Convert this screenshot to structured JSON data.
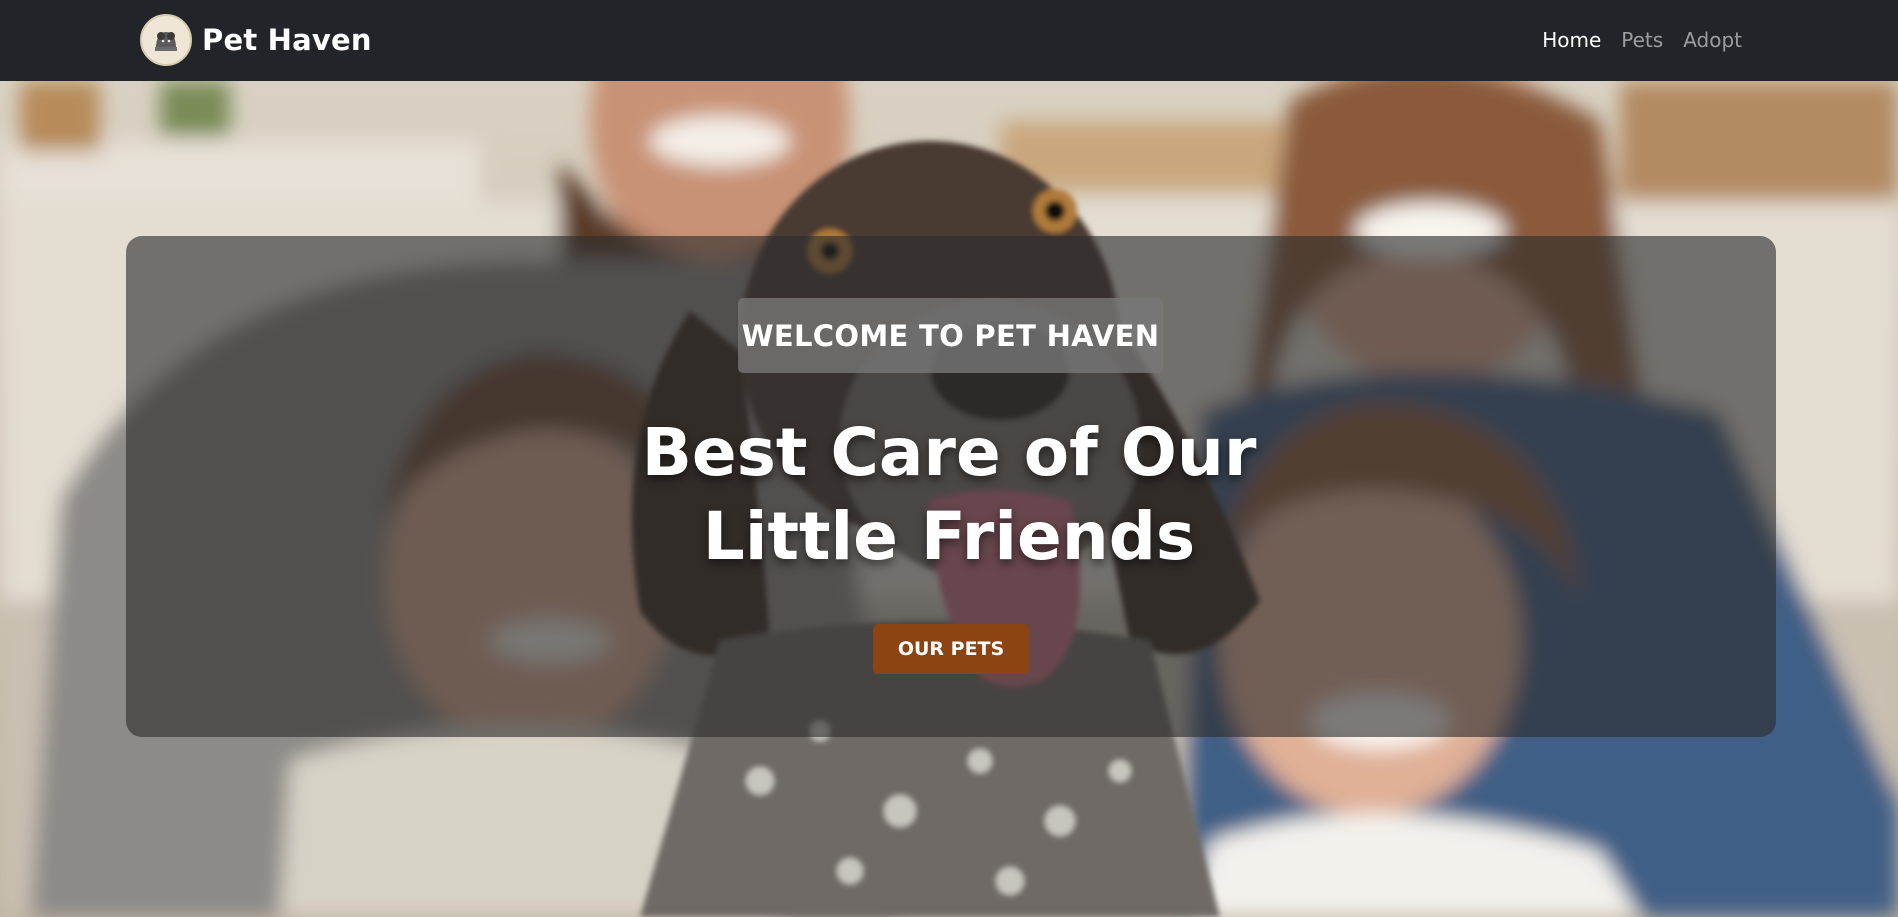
{
  "brand": {
    "name": "Pet Haven",
    "logo": "pet-haven-logo-icon"
  },
  "nav": {
    "items": [
      {
        "label": "Home",
        "active": true
      },
      {
        "label": "Pets",
        "active": false
      },
      {
        "label": "Adopt",
        "active": false
      }
    ]
  },
  "hero": {
    "welcome": "WELCOME TO PET HAVEN",
    "headline_line1": "Best Care of Our",
    "headline_line2": "Little Friends",
    "cta_label": "OUR PETS",
    "image": "family-with-dog-photo"
  },
  "colors": {
    "navbar": "#212529",
    "cta": "#8c4512",
    "text": "#ffffff",
    "nav_muted": "rgba(255,255,255,0.55)"
  }
}
